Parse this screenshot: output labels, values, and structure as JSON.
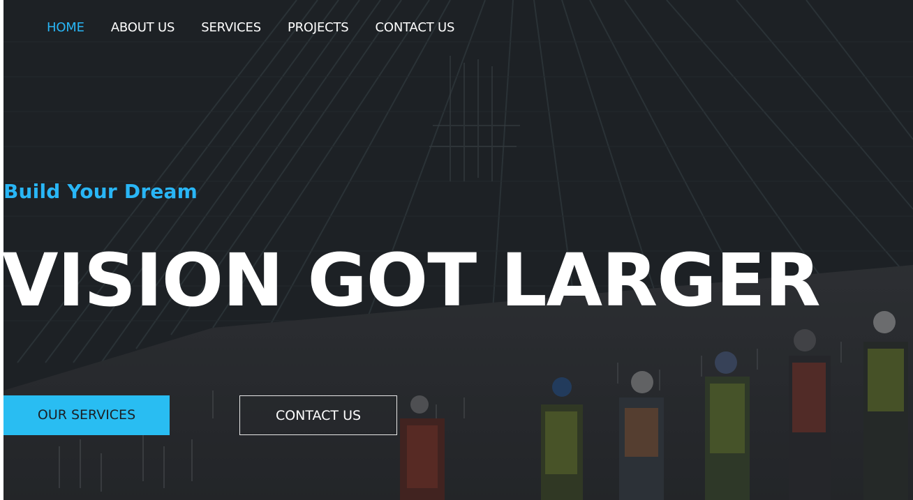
{
  "nav": {
    "items": [
      {
        "label": "HOME",
        "active": true
      },
      {
        "label": "ABOUT US",
        "active": false
      },
      {
        "label": "SERVICES",
        "active": false
      },
      {
        "label": "PROJECTS",
        "active": false
      },
      {
        "label": "CONTACT US",
        "active": false
      }
    ]
  },
  "hero": {
    "kicker": "Build Your Dream",
    "headline": "VISION GOT LARGER",
    "primary_button": "OUR SERVICES",
    "secondary_button": "CONTACT US",
    "background_image": "construction-site-rebar-deck-with-workers"
  },
  "colors": {
    "accent": "#29b6f6",
    "primary_button_bg": "#29bdf2",
    "text": "#ffffff",
    "background": "#24282d"
  }
}
